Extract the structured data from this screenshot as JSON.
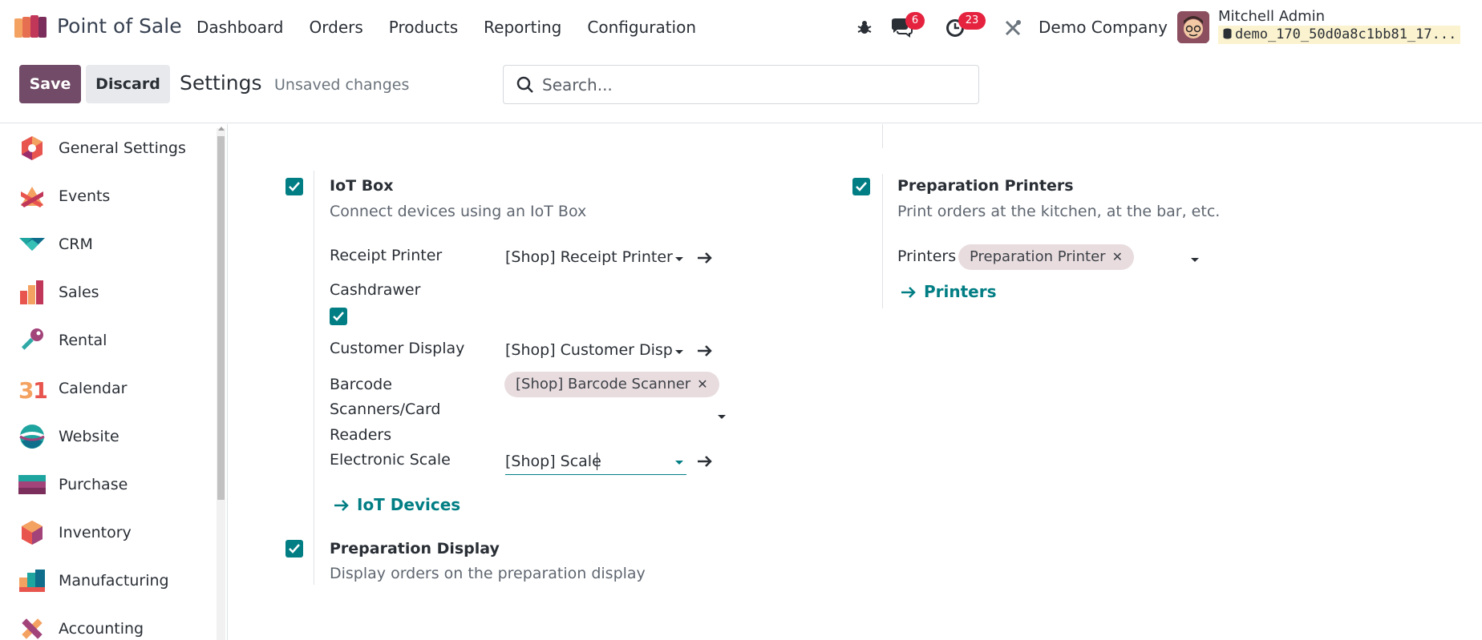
{
  "app": {
    "title": "Point of Sale"
  },
  "menu": [
    {
      "label": "Dashboard"
    },
    {
      "label": "Orders"
    },
    {
      "label": "Products"
    },
    {
      "label": "Reporting"
    },
    {
      "label": "Configuration"
    }
  ],
  "systray": {
    "messages_count": "6",
    "activities_count": "23",
    "company": "Demo Company",
    "user_name": "Mitchell Admin",
    "database": "demo_170_50d0a8c1bb81_17..."
  },
  "control": {
    "save_label": "Save",
    "discard_label": "Discard",
    "title": "Settings",
    "status": "Unsaved changes",
    "search_placeholder": "Search..."
  },
  "sidebar": {
    "items": [
      {
        "label": "General Settings",
        "icon": "general-settings-icon"
      },
      {
        "label": "Events",
        "icon": "events-icon"
      },
      {
        "label": "CRM",
        "icon": "crm-icon"
      },
      {
        "label": "Sales",
        "icon": "sales-icon"
      },
      {
        "label": "Rental",
        "icon": "rental-icon"
      },
      {
        "label": "Calendar",
        "icon": "calendar-icon"
      },
      {
        "label": "Website",
        "icon": "website-icon"
      },
      {
        "label": "Purchase",
        "icon": "purchase-icon"
      },
      {
        "label": "Inventory",
        "icon": "inventory-icon"
      },
      {
        "label": "Manufacturing",
        "icon": "manufacturing-icon"
      },
      {
        "label": "Accounting",
        "icon": "accounting-icon"
      }
    ]
  },
  "iot_box": {
    "checked": true,
    "title": "IoT Box",
    "description": "Connect devices using an IoT Box",
    "receipt_printer_label": "Receipt Printer",
    "receipt_printer_value": "[Shop] Receipt Printer",
    "cashdrawer_label": "Cashdrawer",
    "cashdrawer_checked": true,
    "customer_display_label": "Customer Display",
    "customer_display_value": "[Shop] Customer Displ",
    "barcode_label_1": "Barcode",
    "barcode_label_2": "Scanners/Card",
    "barcode_label_3": "Readers",
    "barcode_tag": "[Shop] Barcode Scanner",
    "scale_label": "Electronic Scale",
    "scale_value": "[Shop] Scale",
    "devices_link": "IoT Devices"
  },
  "preparation_printers": {
    "checked": true,
    "title": "Preparation Printers",
    "description": "Print orders at the kitchen, at the bar, etc.",
    "printers_label": "Printers",
    "printer_tag": "Preparation Printer",
    "printers_link": "Printers"
  },
  "preparation_display": {
    "checked": true,
    "title": "Preparation Display",
    "description": "Display orders on the preparation display"
  },
  "colors": {
    "brand": "#714b67",
    "accent": "#017e84",
    "badge": "#e5233f"
  }
}
